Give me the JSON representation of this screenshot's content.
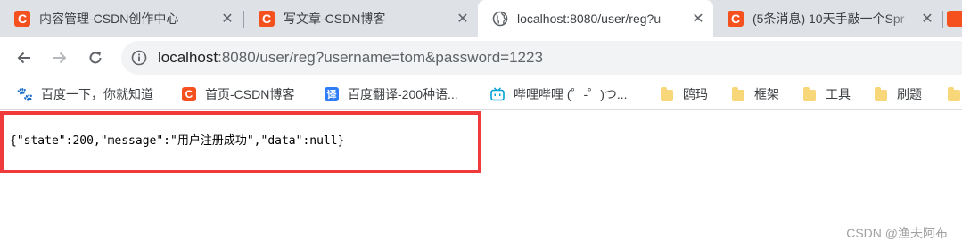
{
  "browser": {
    "tabs": [
      {
        "title": "内容管理-CSDN创作中心",
        "icon": "csdn-icon",
        "active": false
      },
      {
        "title": "写文章-CSDN博客",
        "icon": "csdn-icon",
        "active": false
      },
      {
        "title": "localhost:8080/user/reg?u",
        "icon": "globe-icon",
        "active": true
      },
      {
        "title": "(5条消息) 10天手敲一个Spr",
        "icon": "csdn-icon",
        "active": false
      }
    ],
    "close_glyph": "✕",
    "url_host": "localhost",
    "url_rest": ":8080/user/reg?username=tom&password=1223",
    "bookmarks": [
      {
        "label": "百度一下，你就知道",
        "icon": "baidu-icon"
      },
      {
        "label": "首页-CSDN博客",
        "icon": "csdn-icon"
      },
      {
        "label": "百度翻译-200种语...",
        "icon": "translate-icon"
      },
      {
        "label": "哔哩哔哩 (゜-゜)つ...",
        "icon": "bilibili-icon"
      },
      {
        "label": "鸥玛",
        "icon": "folder-icon"
      },
      {
        "label": "框架",
        "icon": "folder-icon"
      },
      {
        "label": "工具",
        "icon": "folder-icon"
      },
      {
        "label": "刷题",
        "icon": "folder-icon"
      }
    ],
    "bookmark_glyphs": {
      "csdn": "C",
      "translate": "译",
      "baidu": "🐾"
    }
  },
  "page": {
    "response_text": "{\"state\":200,\"message\":\"用户注册成功\",\"data\":null}",
    "watermark": "CSDN @渔夫阿布"
  },
  "colors": {
    "csdn_brand": "#f4511e",
    "highlight_border": "#ef3b3b",
    "tabstrip_bg": "#dee1e6"
  }
}
